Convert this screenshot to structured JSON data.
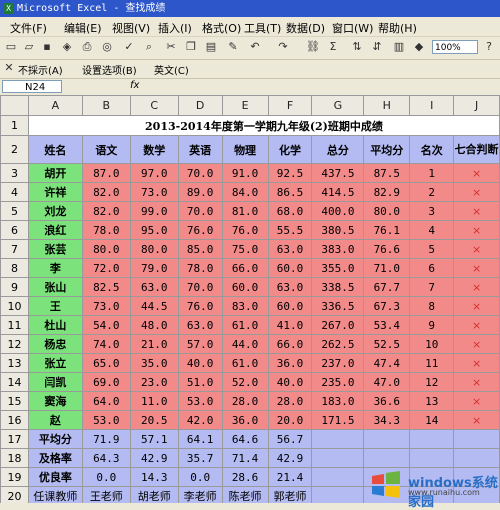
{
  "window": {
    "title": "Microsoft Excel - 查找成绩"
  },
  "menu": [
    "文件(F)",
    "编辑(E)",
    "视图(V)",
    "插入(I)",
    "格式(O)",
    "工具(T)",
    "数据(D)",
    "窗口(W)",
    "帮助(H)"
  ],
  "toolbar": {
    "zoom": "100%"
  },
  "toolbar2": [
    "不採示(A)",
    "设置选项(B)",
    "英文(C)"
  ],
  "formula": {
    "namebox": "N24",
    "fx": "fx"
  },
  "columns": [
    "A",
    "B",
    "C",
    "D",
    "E",
    "F",
    "G",
    "H",
    "I",
    "J"
  ],
  "rows": [
    {
      "n": "1",
      "cells": [
        {
          "t": "2013-2014年度第一学期九年级(2)班期中成绩",
          "span": 10,
          "c": "title"
        }
      ]
    },
    {
      "n": "2",
      "cells": [
        {
          "t": "姓名",
          "c": "p hdrcell"
        },
        {
          "t": "语文",
          "c": "p hdrcell"
        },
        {
          "t": "数学",
          "c": "p hdrcell"
        },
        {
          "t": "英语",
          "c": "p hdrcell"
        },
        {
          "t": "物理",
          "c": "p hdrcell"
        },
        {
          "t": "化学",
          "c": "p hdrcell"
        },
        {
          "t": "总分",
          "c": "p hdrcell"
        },
        {
          "t": "平均分",
          "c": "p hdrcell"
        },
        {
          "t": "名次",
          "c": "p hdrcell"
        },
        {
          "t": "七合判断",
          "c": "p hdrcell"
        }
      ]
    },
    {
      "n": "3",
      "cells": [
        {
          "t": "胡开",
          "c": "g name"
        },
        {
          "t": "87.0",
          "c": "r num"
        },
        {
          "t": "97.0",
          "c": "r num"
        },
        {
          "t": "70.0",
          "c": "r num"
        },
        {
          "t": "91.0",
          "c": "r num"
        },
        {
          "t": "92.5",
          "c": "r num"
        },
        {
          "t": "437.5",
          "c": "r num"
        },
        {
          "t": "87.5",
          "c": "r num"
        },
        {
          "t": "1",
          "c": "r num"
        },
        {
          "t": "×",
          "c": "r x"
        }
      ]
    },
    {
      "n": "4",
      "cells": [
        {
          "t": "许祥",
          "c": "g name"
        },
        {
          "t": "82.0",
          "c": "r num"
        },
        {
          "t": "73.0",
          "c": "r num"
        },
        {
          "t": "89.0",
          "c": "r num"
        },
        {
          "t": "84.0",
          "c": "r num"
        },
        {
          "t": "86.5",
          "c": "r num"
        },
        {
          "t": "414.5",
          "c": "r num"
        },
        {
          "t": "82.9",
          "c": "r num"
        },
        {
          "t": "2",
          "c": "r num"
        },
        {
          "t": "×",
          "c": "r x"
        }
      ]
    },
    {
      "n": "5",
      "cells": [
        {
          "t": "刘龙",
          "c": "g name"
        },
        {
          "t": "82.0",
          "c": "r num"
        },
        {
          "t": "99.0",
          "c": "r num"
        },
        {
          "t": "70.0",
          "c": "r num"
        },
        {
          "t": "81.0",
          "c": "r num"
        },
        {
          "t": "68.0",
          "c": "r num"
        },
        {
          "t": "400.0",
          "c": "r num"
        },
        {
          "t": "80.0",
          "c": "r num"
        },
        {
          "t": "3",
          "c": "r num"
        },
        {
          "t": "×",
          "c": "r x"
        }
      ]
    },
    {
      "n": "6",
      "cells": [
        {
          "t": "浪红",
          "c": "g name"
        },
        {
          "t": "78.0",
          "c": "r num"
        },
        {
          "t": "95.0",
          "c": "r num"
        },
        {
          "t": "76.0",
          "c": "r num"
        },
        {
          "t": "76.0",
          "c": "r num"
        },
        {
          "t": "55.5",
          "c": "r num"
        },
        {
          "t": "380.5",
          "c": "r num"
        },
        {
          "t": "76.1",
          "c": "r num"
        },
        {
          "t": "4",
          "c": "r num"
        },
        {
          "t": "×",
          "c": "r x"
        }
      ]
    },
    {
      "n": "7",
      "cells": [
        {
          "t": "张芸",
          "c": "g name"
        },
        {
          "t": "80.0",
          "c": "r num"
        },
        {
          "t": "80.0",
          "c": "r num"
        },
        {
          "t": "85.0",
          "c": "r num"
        },
        {
          "t": "75.0",
          "c": "r num"
        },
        {
          "t": "63.0",
          "c": "r num"
        },
        {
          "t": "383.0",
          "c": "r num"
        },
        {
          "t": "76.6",
          "c": "r num"
        },
        {
          "t": "5",
          "c": "r num"
        },
        {
          "t": "×",
          "c": "r x"
        }
      ]
    },
    {
      "n": "8",
      "cells": [
        {
          "t": "李",
          "c": "g name"
        },
        {
          "t": "72.0",
          "c": "r num"
        },
        {
          "t": "79.0",
          "c": "r num"
        },
        {
          "t": "78.0",
          "c": "r num"
        },
        {
          "t": "66.0",
          "c": "r num"
        },
        {
          "t": "60.0",
          "c": "r num"
        },
        {
          "t": "355.0",
          "c": "r num"
        },
        {
          "t": "71.0",
          "c": "r num"
        },
        {
          "t": "6",
          "c": "r num"
        },
        {
          "t": "×",
          "c": "r x"
        }
      ]
    },
    {
      "n": "9",
      "cells": [
        {
          "t": "张山",
          "c": "g name"
        },
        {
          "t": "82.5",
          "c": "r num"
        },
        {
          "t": "63.0",
          "c": "r num"
        },
        {
          "t": "70.0",
          "c": "r num"
        },
        {
          "t": "60.0",
          "c": "r num"
        },
        {
          "t": "63.0",
          "c": "r num"
        },
        {
          "t": "338.5",
          "c": "r num"
        },
        {
          "t": "67.7",
          "c": "r num"
        },
        {
          "t": "7",
          "c": "r num"
        },
        {
          "t": "×",
          "c": "r x"
        }
      ]
    },
    {
      "n": "10",
      "cells": [
        {
          "t": "王",
          "c": "g name"
        },
        {
          "t": "73.0",
          "c": "r num"
        },
        {
          "t": "44.5",
          "c": "r num"
        },
        {
          "t": "76.0",
          "c": "r num"
        },
        {
          "t": "83.0",
          "c": "r num"
        },
        {
          "t": "60.0",
          "c": "r num"
        },
        {
          "t": "336.5",
          "c": "r num"
        },
        {
          "t": "67.3",
          "c": "r num"
        },
        {
          "t": "8",
          "c": "r num"
        },
        {
          "t": "×",
          "c": "r x"
        }
      ]
    },
    {
      "n": "11",
      "cells": [
        {
          "t": "杜山",
          "c": "g name"
        },
        {
          "t": "54.0",
          "c": "r num"
        },
        {
          "t": "48.0",
          "c": "r num"
        },
        {
          "t": "63.0",
          "c": "r num"
        },
        {
          "t": "61.0",
          "c": "r num"
        },
        {
          "t": "41.0",
          "c": "r num"
        },
        {
          "t": "267.0",
          "c": "r num"
        },
        {
          "t": "53.4",
          "c": "r num"
        },
        {
          "t": "9",
          "c": "r num"
        },
        {
          "t": "×",
          "c": "r x"
        }
      ]
    },
    {
      "n": "12",
      "cells": [
        {
          "t": "杨忠",
          "c": "g name"
        },
        {
          "t": "74.0",
          "c": "r num"
        },
        {
          "t": "21.0",
          "c": "r num"
        },
        {
          "t": "57.0",
          "c": "r num"
        },
        {
          "t": "44.0",
          "c": "r num"
        },
        {
          "t": "66.0",
          "c": "r num"
        },
        {
          "t": "262.5",
          "c": "r num"
        },
        {
          "t": "52.5",
          "c": "r num"
        },
        {
          "t": "10",
          "c": "r num"
        },
        {
          "t": "×",
          "c": "r x"
        }
      ]
    },
    {
      "n": "13",
      "cells": [
        {
          "t": "张立",
          "c": "g name"
        },
        {
          "t": "65.0",
          "c": "r num"
        },
        {
          "t": "35.0",
          "c": "r num"
        },
        {
          "t": "40.0",
          "c": "r num"
        },
        {
          "t": "61.0",
          "c": "r num"
        },
        {
          "t": "36.0",
          "c": "r num"
        },
        {
          "t": "237.0",
          "c": "r num"
        },
        {
          "t": "47.4",
          "c": "r num"
        },
        {
          "t": "11",
          "c": "r num"
        },
        {
          "t": "×",
          "c": "r x"
        }
      ]
    },
    {
      "n": "14",
      "cells": [
        {
          "t": "闫凯",
          "c": "g name"
        },
        {
          "t": "69.0",
          "c": "r num"
        },
        {
          "t": "23.0",
          "c": "r num"
        },
        {
          "t": "51.0",
          "c": "r num"
        },
        {
          "t": "52.0",
          "c": "r num"
        },
        {
          "t": "40.0",
          "c": "r num"
        },
        {
          "t": "235.0",
          "c": "r num"
        },
        {
          "t": "47.0",
          "c": "r num"
        },
        {
          "t": "12",
          "c": "r num"
        },
        {
          "t": "×",
          "c": "r x"
        }
      ]
    },
    {
      "n": "15",
      "cells": [
        {
          "t": "窦海",
          "c": "g name"
        },
        {
          "t": "64.0",
          "c": "r num"
        },
        {
          "t": "11.0",
          "c": "r num"
        },
        {
          "t": "53.0",
          "c": "r num"
        },
        {
          "t": "28.0",
          "c": "r num"
        },
        {
          "t": "28.0",
          "c": "r num"
        },
        {
          "t": "183.0",
          "c": "r num"
        },
        {
          "t": "36.6",
          "c": "r num"
        },
        {
          "t": "13",
          "c": "r num"
        },
        {
          "t": "×",
          "c": "r x"
        }
      ]
    },
    {
      "n": "16",
      "cells": [
        {
          "t": "赵",
          "c": "g name"
        },
        {
          "t": "53.0",
          "c": "r num"
        },
        {
          "t": "20.5",
          "c": "r num"
        },
        {
          "t": "42.0",
          "c": "r num"
        },
        {
          "t": "36.0",
          "c": "r num"
        },
        {
          "t": "20.0",
          "c": "r num"
        },
        {
          "t": "171.5",
          "c": "r num"
        },
        {
          "t": "34.3",
          "c": "r num"
        },
        {
          "t": "14",
          "c": "r num"
        },
        {
          "t": "×",
          "c": "r x"
        }
      ]
    },
    {
      "n": "17",
      "cells": [
        {
          "t": "平均分",
          "c": "p bold"
        },
        {
          "t": "71.9",
          "c": "p num"
        },
        {
          "t": "57.1",
          "c": "p num"
        },
        {
          "t": "64.1",
          "c": "p num"
        },
        {
          "t": "64.6",
          "c": "p num"
        },
        {
          "t": "56.7",
          "c": "p num"
        },
        {
          "t": "",
          "c": "p"
        },
        {
          "t": "",
          "c": "p"
        },
        {
          "t": "",
          "c": "p"
        },
        {
          "t": "",
          "c": "p"
        }
      ]
    },
    {
      "n": "18",
      "cells": [
        {
          "t": "及格率",
          "c": "p bold"
        },
        {
          "t": "64.3",
          "c": "p num"
        },
        {
          "t": "42.9",
          "c": "p num"
        },
        {
          "t": "35.7",
          "c": "p num"
        },
        {
          "t": "71.4",
          "c": "p num"
        },
        {
          "t": "42.9",
          "c": "p num"
        },
        {
          "t": "",
          "c": "p"
        },
        {
          "t": "",
          "c": "p"
        },
        {
          "t": "",
          "c": "p"
        },
        {
          "t": "",
          "c": "p"
        }
      ]
    },
    {
      "n": "19",
      "cells": [
        {
          "t": "优良率",
          "c": "p bold"
        },
        {
          "t": "0.0",
          "c": "p num"
        },
        {
          "t": "14.3",
          "c": "p num"
        },
        {
          "t": "0.0",
          "c": "p num"
        },
        {
          "t": "28.6",
          "c": "p num"
        },
        {
          "t": "21.4",
          "c": "p num"
        },
        {
          "t": "",
          "c": "p"
        },
        {
          "t": "",
          "c": "p"
        },
        {
          "t": "",
          "c": "p"
        },
        {
          "t": "",
          "c": "p"
        }
      ]
    },
    {
      "n": "20",
      "cells": [
        {
          "t": "任课教师",
          "c": "p"
        },
        {
          "t": "王老师",
          "c": "p"
        },
        {
          "t": "胡老师",
          "c": "p"
        },
        {
          "t": "李老师",
          "c": "p"
        },
        {
          "t": "陈老师",
          "c": "p"
        },
        {
          "t": "郭老师",
          "c": "p"
        },
        {
          "t": "",
          "c": "p"
        },
        {
          "t": "",
          "c": "p"
        },
        {
          "t": "",
          "c": "p"
        },
        {
          "t": "",
          "c": "p"
        }
      ]
    }
  ],
  "watermark": {
    "text": "windows系统家园",
    "sub": "www.runaihu.com"
  }
}
